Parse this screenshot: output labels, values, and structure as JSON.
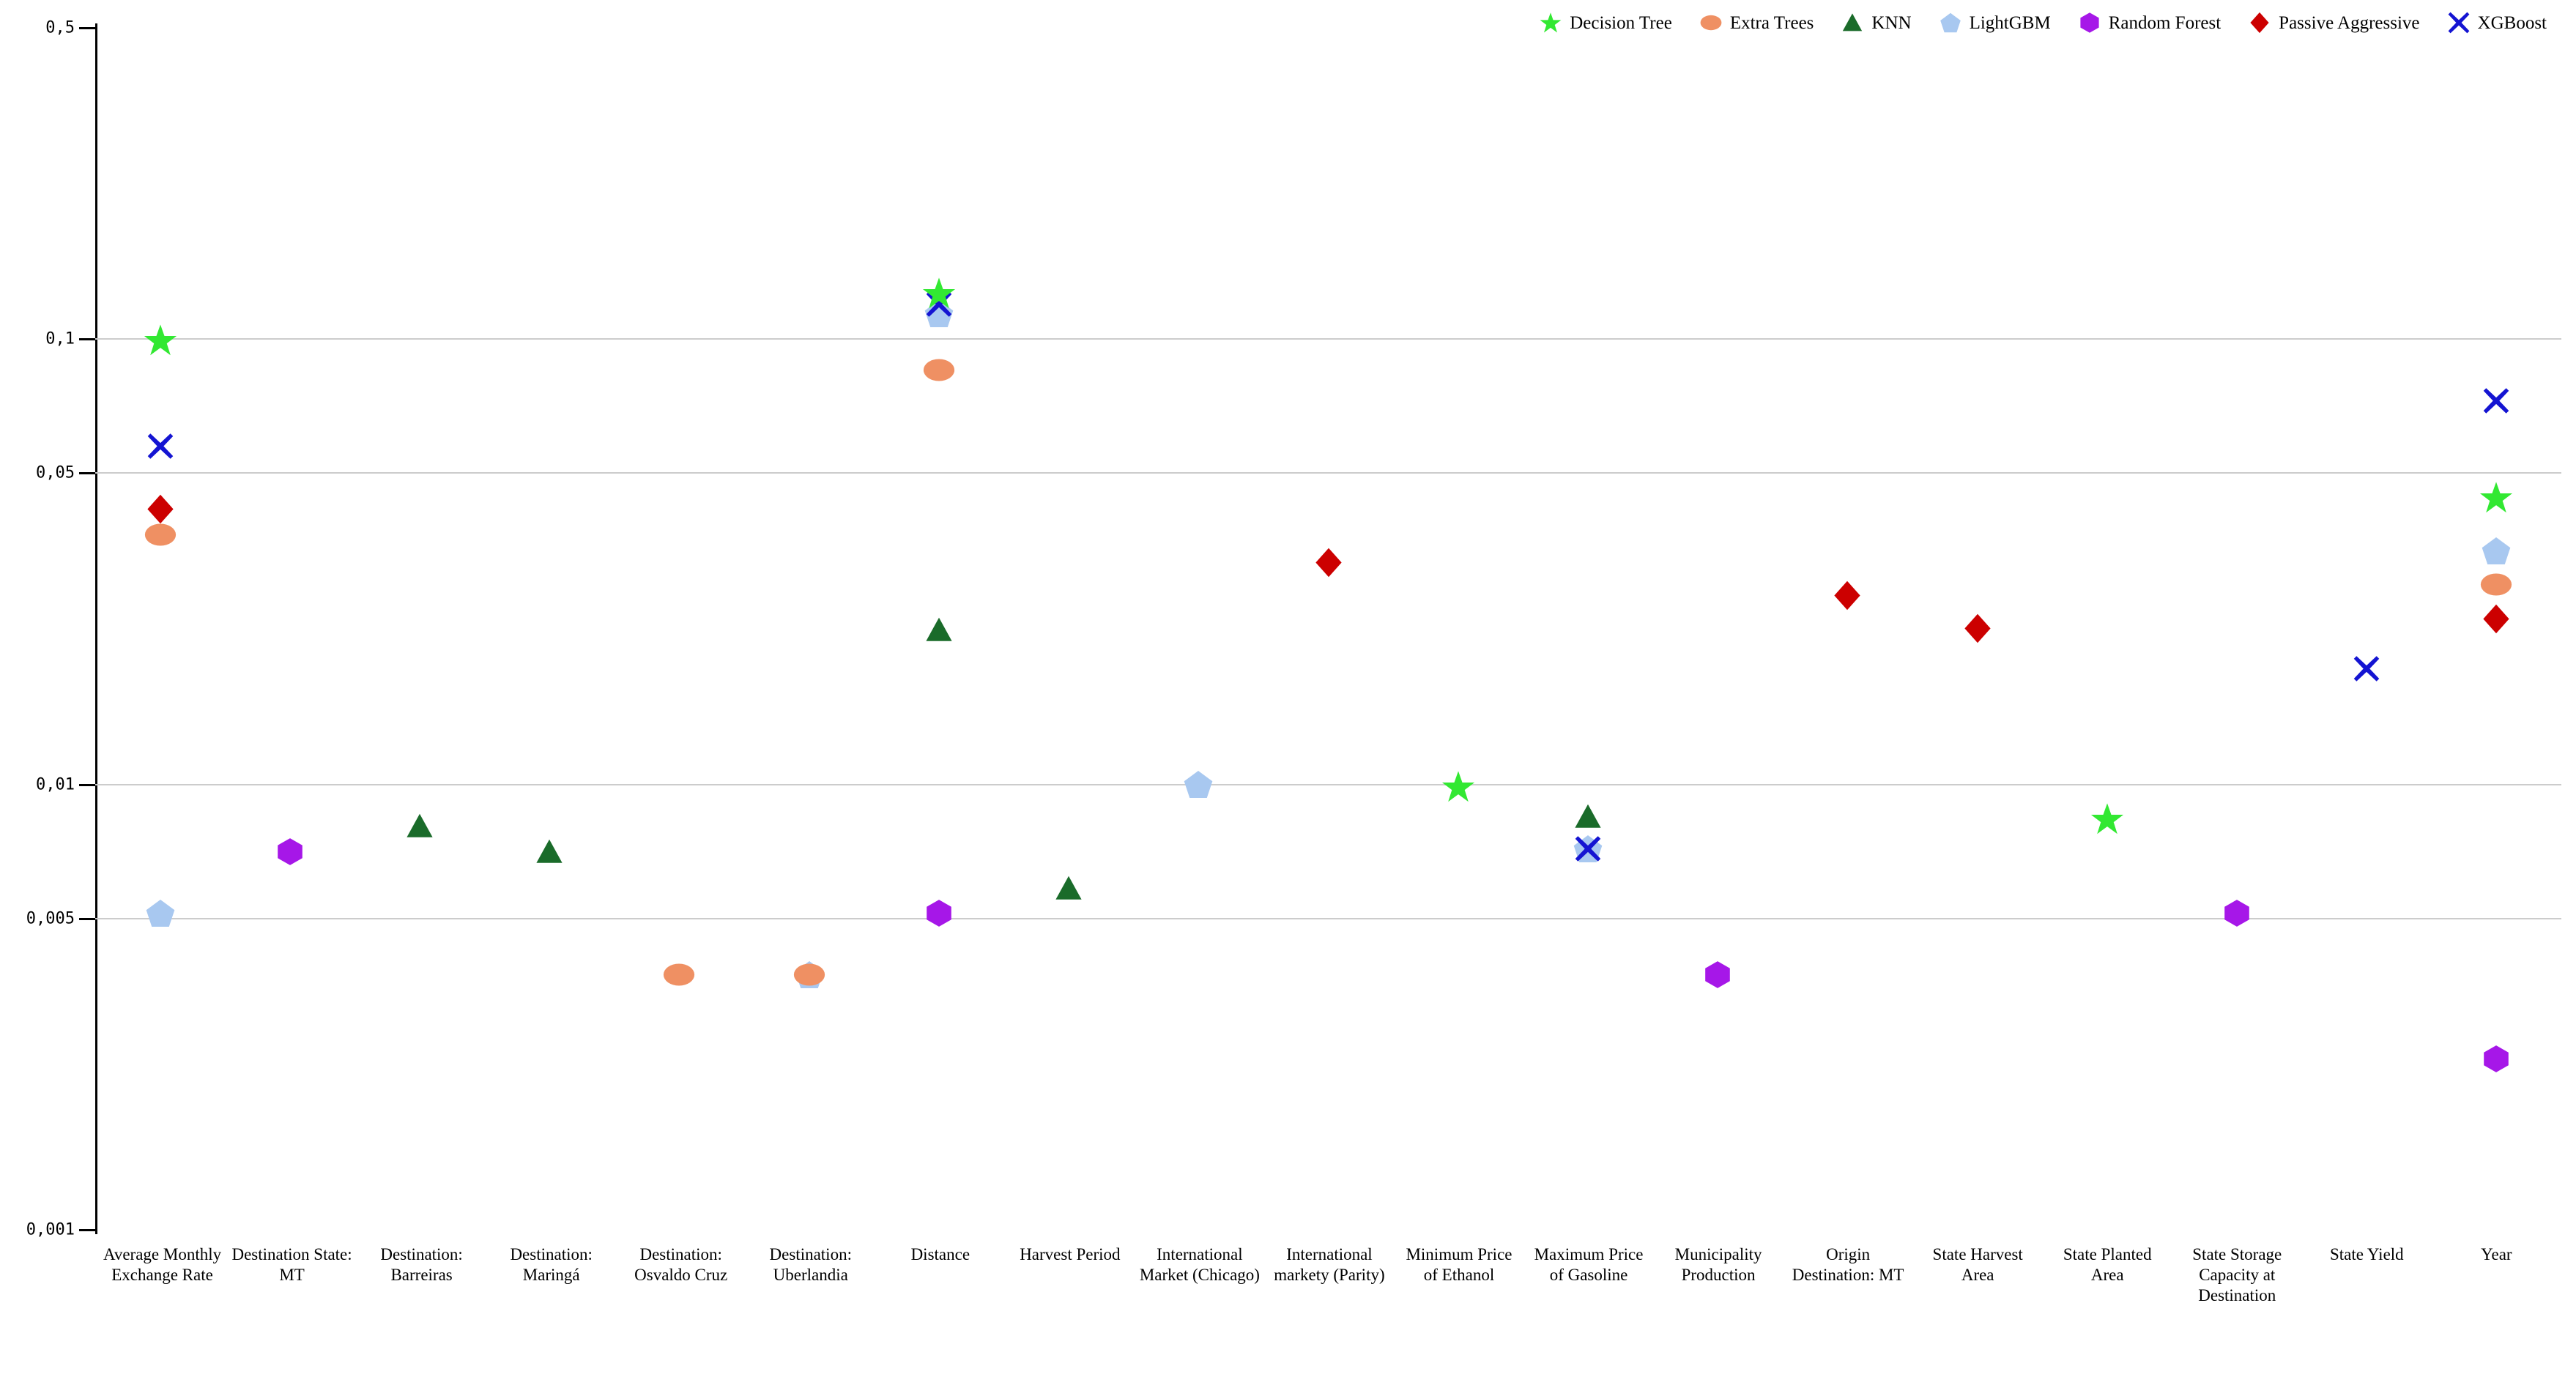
{
  "legend": {
    "position": "top-right",
    "entries": [
      {
        "label": "Decision Tree",
        "icon": "star-marker",
        "color": "#32e832"
      },
      {
        "label": "Extra Trees",
        "icon": "ellipse-marker",
        "color": "#ef9063"
      },
      {
        "label": "KNN",
        "icon": "triangle-marker",
        "color": "#1a6b2a"
      },
      {
        "label": "LightGBM",
        "icon": "pentagon-marker",
        "color": "#a8c8f0"
      },
      {
        "label": "Random Forest",
        "icon": "hexagon-marker",
        "color": "#a617e8"
      },
      {
        "label": "Passive Aggressive",
        "icon": "diamond-marker",
        "color": "#cc0000"
      },
      {
        "label": "XGBoost",
        "icon": "cross-x-marker",
        "color": "#1414d2"
      }
    ]
  },
  "chart_data": {
    "type": "scatter",
    "title": "",
    "xlabel": "",
    "ylabel": "",
    "yscale": "log",
    "ylim": [
      0.001,
      0.5
    ],
    "grid": true,
    "decimal_separator": ",",
    "ytick_labels": [
      "0,5",
      "0,1",
      "0,05",
      "0,01",
      "0,005",
      "0,001"
    ],
    "ytick_values": [
      0.5,
      0.1,
      0.05,
      0.01,
      0.005,
      0.001
    ],
    "categories": [
      "Average Monthly Exchange Rate",
      "Destination State: MT",
      "Destination: Barreiras",
      "Destination: Maringá",
      "Destination: Osvaldo Cruz",
      "Destination: Uberlandia",
      "Distance",
      "Harvest Period",
      "International Market (Chicago)",
      "International markety (Parity)",
      "Minimum Price of Ethanol",
      "Maximum Price of Gasoline",
      "Municipality Production",
      "Origin Destination: MT",
      "State Harvest Area",
      "State Planted Area",
      "State Storage Capacity at Destination",
      "State Yield",
      "Year"
    ],
    "series": [
      {
        "name": "Decision Tree",
        "color": "#32e832",
        "marker": "star",
        "points": [
          {
            "category": "Average Monthly Exchange Rate",
            "value": 0.0985
          },
          {
            "category": "Distance",
            "value": 0.1255
          },
          {
            "category": "Minimum Price of Ethanol",
            "value": 0.0098
          },
          {
            "category": "State Planted Area",
            "value": 0.0083
          },
          {
            "category": "Year",
            "value": 0.0437
          }
        ]
      },
      {
        "name": "Extra Trees",
        "color": "#ef9063",
        "marker": "ellipse",
        "points": [
          {
            "category": "Average Monthly Exchange Rate",
            "value": 0.036
          },
          {
            "category": "Destination: Osvaldo Cruz",
            "value": 0.0037
          },
          {
            "category": "Destination: Uberlandia",
            "value": 0.0037
          },
          {
            "category": "Distance",
            "value": 0.0845
          },
          {
            "category": "Year",
            "value": 0.0278
          }
        ]
      },
      {
        "name": "KNN",
        "color": "#1a6b2a",
        "marker": "triangle",
        "points": [
          {
            "category": "Destination: Barreiras",
            "value": 0.008
          },
          {
            "category": "Destination: Maringá",
            "value": 0.007
          },
          {
            "category": "Distance",
            "value": 0.022
          },
          {
            "category": "Harvest Period",
            "value": 0.0058
          },
          {
            "category": "Maximum Price of Gasoline",
            "value": 0.0084
          }
        ]
      },
      {
        "name": "LightGBM",
        "color": "#a8c8f0",
        "marker": "pentagon",
        "points": [
          {
            "category": "Average Monthly Exchange Rate",
            "value": 0.0051
          },
          {
            "category": "Destination: Uberlandia",
            "value": 0.0037
          },
          {
            "category": "Distance",
            "value": 0.113
          },
          {
            "category": "International Market (Chicago)",
            "value": 0.0099
          },
          {
            "category": "Maximum Price of Gasoline",
            "value": 0.0071
          },
          {
            "category": "Year",
            "value": 0.0332
          }
        ]
      },
      {
        "name": "Random Forest",
        "color": "#a617e8",
        "marker": "hexagon",
        "points": [
          {
            "category": "Destination State: MT",
            "value": 0.007
          },
          {
            "category": "Distance",
            "value": 0.0051
          },
          {
            "category": "Municipality Production",
            "value": 0.0037
          },
          {
            "category": "State Storage Capacity at Destination",
            "value": 0.0051
          },
          {
            "category": "Year",
            "value": 0.0024
          }
        ]
      },
      {
        "name": "Passive Aggressive",
        "color": "#cc0000",
        "marker": "diamond",
        "points": [
          {
            "category": "Average Monthly Exchange Rate",
            "value": 0.0412
          },
          {
            "category": "International markety (Parity)",
            "value": 0.0312
          },
          {
            "category": "Origin Destination: MT",
            "value": 0.0263
          },
          {
            "category": "State Harvest Area",
            "value": 0.0222
          },
          {
            "category": "Year",
            "value": 0.0233
          }
        ]
      },
      {
        "name": "XGBoost",
        "color": "#1414d2",
        "marker": "cross",
        "points": [
          {
            "category": "Average Monthly Exchange Rate",
            "value": 0.057
          },
          {
            "category": "Distance",
            "value": 0.1185
          },
          {
            "category": "Maximum Price of Gasoline",
            "value": 0.0071
          },
          {
            "category": "State Yield",
            "value": 0.018
          },
          {
            "category": "Year",
            "value": 0.072
          }
        ]
      }
    ]
  }
}
